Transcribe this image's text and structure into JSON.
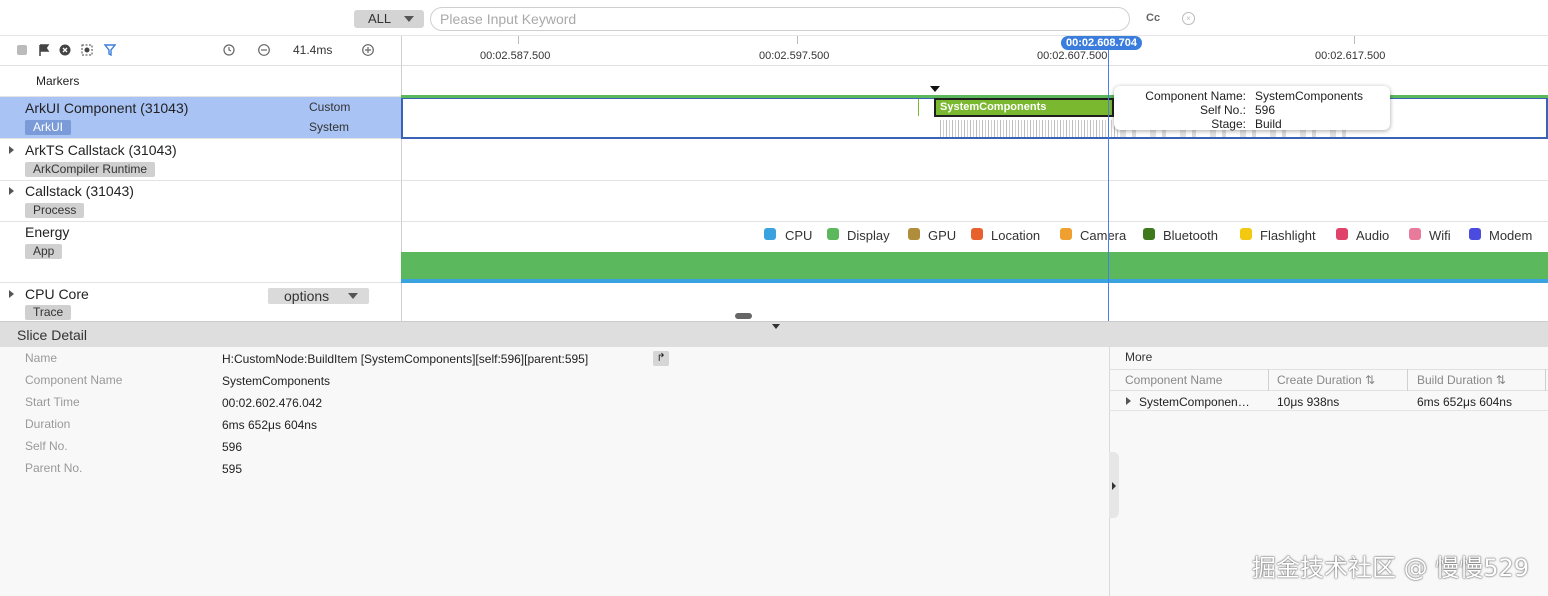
{
  "search": {
    "filter_value": "ALL",
    "placeholder": "Please Input Keyword",
    "case_label": "Cc",
    "clear_label": "×"
  },
  "toolbar": {
    "zoom_level": "41.4ms",
    "icons": [
      "stop-icon",
      "flag-icon",
      "record-icon",
      "screenshot-icon",
      "filter-icon",
      "clock-icon",
      "zoom-out-icon",
      "zoom-in-icon"
    ]
  },
  "ruler": {
    "ticks": [
      "00:02.587.500",
      "00:02.597.500",
      "00:02.607.500",
      "00:02.617.500"
    ],
    "cursor_time": "00:02.608.704"
  },
  "rows": {
    "markers": "Markers",
    "arkui": {
      "title": "ArkUI Component (31043)",
      "tag": "ArkUI",
      "sub1": "Custom",
      "sub2": "System"
    },
    "arkts": {
      "title": "ArkTS Callstack (31043)",
      "tag": "ArkCompiler Runtime"
    },
    "callstack": {
      "title": "Callstack (31043)",
      "tag": "Process"
    },
    "energy": {
      "title": "Energy",
      "tag": "App"
    },
    "cpu": {
      "title": "CPU Core",
      "tag": "Trace",
      "options_label": "options"
    }
  },
  "slice": {
    "label": "SystemComponents"
  },
  "tooltip": {
    "k1": "Component Name:",
    "v1": "SystemComponents",
    "k2": "Self No.:",
    "v2": "596",
    "k3": "Stage:",
    "v3": "Build"
  },
  "energy_legend": [
    {
      "label": "CPU",
      "color": "#3aa2df"
    },
    {
      "label": "Display",
      "color": "#5cb85c"
    },
    {
      "label": "GPU",
      "color": "#b08d3a"
    },
    {
      "label": "Location",
      "color": "#e8612c"
    },
    {
      "label": "Camera",
      "color": "#f0a030"
    },
    {
      "label": "Bluetooth",
      "color": "#3e7a1c"
    },
    {
      "label": "Flashlight",
      "color": "#f2c811"
    },
    {
      "label": "Audio",
      "color": "#e0426a"
    },
    {
      "label": "Wifi",
      "color": "#e87a9c"
    },
    {
      "label": "Modem",
      "color": "#4b4be0"
    }
  ],
  "detail": {
    "title": "Slice Detail",
    "fields": [
      {
        "key": "Name",
        "value": "H:CustomNode:BuildItem [SystemComponents][self:596][parent:595]"
      },
      {
        "key": "Component Name",
        "value": "SystemComponents"
      },
      {
        "key": "Start Time",
        "value": "00:02.602.476.042"
      },
      {
        "key": "Duration",
        "value": "6ms 652μs 604ns"
      },
      {
        "key": "Self No.",
        "value": "596"
      },
      {
        "key": "Parent No.",
        "value": "595"
      }
    ],
    "jump_icon": "↱",
    "more_label": "More",
    "table": {
      "headers": [
        "Component Name",
        "Create Duration ⇅",
        "Build Duration ⇅"
      ],
      "rows": [
        {
          "name": "SystemComponen…",
          "create": "10μs 938ns",
          "build": "6ms 652μs 604ns"
        }
      ]
    }
  },
  "watermark": "掘金技术社区 @ 慢慢529"
}
